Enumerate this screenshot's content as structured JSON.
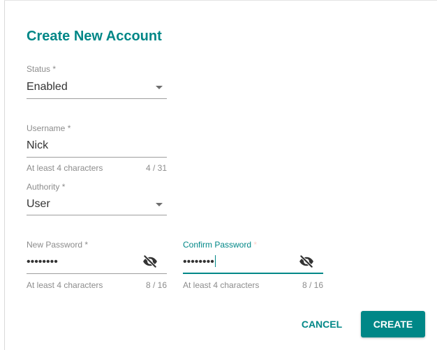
{
  "dialog": {
    "title": "Create New Account"
  },
  "status": {
    "label": "Status",
    "required": "*",
    "value": "Enabled"
  },
  "username": {
    "label": "Username",
    "required": "*",
    "value": "Nick",
    "hint": "At least 4 characters",
    "counter": "4 / 31"
  },
  "authority": {
    "label": "Authority",
    "required": "*",
    "value": "User"
  },
  "new_password": {
    "label": "New Password",
    "required": "*",
    "masked_value": "••••••••",
    "hint": "At least 4 characters",
    "counter": "8 / 16",
    "toggle_icon": "eye-off-icon"
  },
  "confirm_password": {
    "label": "Confirm Password",
    "required": "*",
    "masked_value": "••••••••",
    "hint": "At least 4 characters",
    "counter": "8 / 16",
    "toggle_icon": "eye-off-icon"
  },
  "actions": {
    "cancel_label": "CANCEL",
    "create_label": "CREATE"
  },
  "colors": {
    "accent": "#008787",
    "label_gray": "#8c8c8c",
    "text": "#333333"
  }
}
